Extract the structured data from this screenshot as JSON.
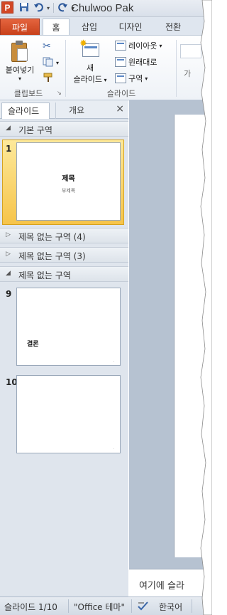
{
  "app": {
    "icon_letter": "P",
    "window_title": "Chulwoo Pak"
  },
  "quick_access": [
    "save-icon",
    "undo-icon",
    "redo-icon"
  ],
  "tabs": {
    "file": "파일",
    "home": "홈",
    "insert": "삽입",
    "design": "디자인",
    "transitions": "전환"
  },
  "ribbon": {
    "clipboard": {
      "label": "클립보드",
      "paste": "붙여넣기"
    },
    "slides": {
      "label": "슬라이드",
      "new_slide_line1": "새",
      "new_slide_line2": "슬라이드",
      "layout": "레이아웃",
      "reset": "원래대로",
      "section": "구역"
    },
    "cut_off_label": "가"
  },
  "panel": {
    "tab_slides": "슬라이드",
    "tab_outline": "개요",
    "close": "×"
  },
  "sections": [
    {
      "name": "기본 구역",
      "expanded": true
    },
    {
      "name": "제목 없는 구역 (4)",
      "expanded": false
    },
    {
      "name": "제목 없는 구역 (3)",
      "expanded": false
    },
    {
      "name": "제목 없는 구역",
      "expanded": true
    }
  ],
  "slides": [
    {
      "number": "1",
      "title": "제목",
      "subtitle": "부제목",
      "selected": true
    },
    {
      "number": "9",
      "title": "결론",
      "selected": false
    },
    {
      "number": "10",
      "title": "",
      "selected": false
    }
  ],
  "notes": {
    "placeholder": "여기에 슬라"
  },
  "status": {
    "slide_indicator": "슬라이드 1/10",
    "theme": "\"Office 테마\"",
    "language": "한국어"
  }
}
